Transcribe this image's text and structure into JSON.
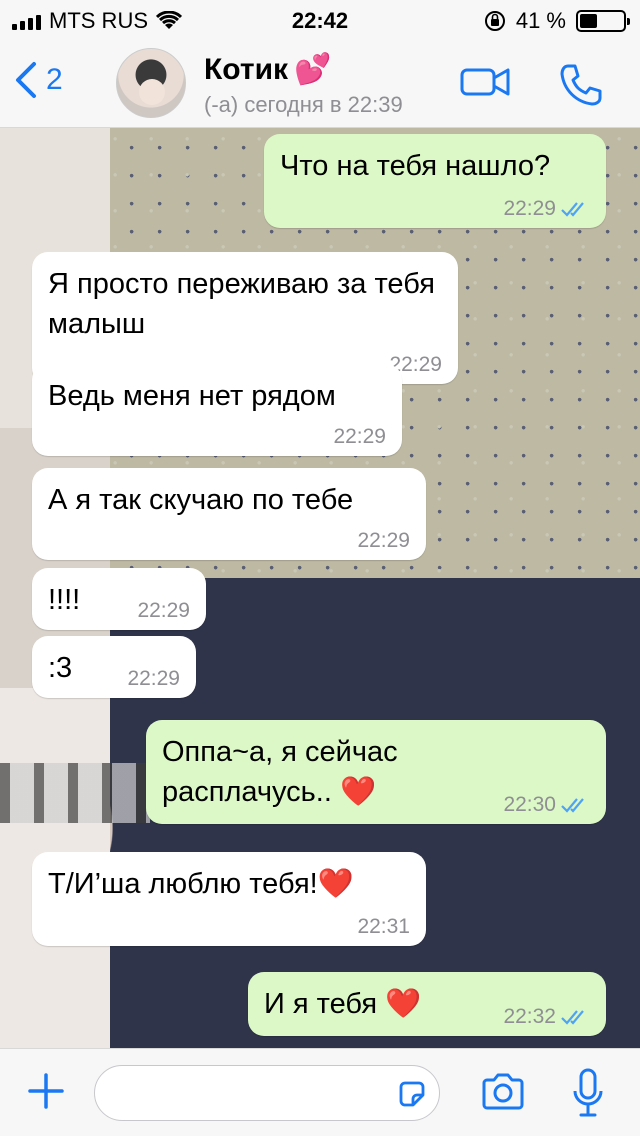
{
  "status_bar": {
    "carrier": "MTS RUS",
    "time": "22:42",
    "battery": "41 %",
    "battery_level": 0.41
  },
  "header": {
    "back_count": "2",
    "contact_name": "Котик",
    "contact_emoji": "💕",
    "status": "(-а) сегодня в 22:39"
  },
  "messages": [
    {
      "direction": "out",
      "text": "Что на тебя нашло?",
      "time": "22:29",
      "read": true
    },
    {
      "direction": "in",
      "text": "Я просто переживаю за тебя малыш",
      "time": "22:29"
    },
    {
      "direction": "in",
      "text": "Ведь меня нет рядом",
      "time": "22:29"
    },
    {
      "direction": "in",
      "text": "А я так скучаю по тебе",
      "time": "22:29"
    },
    {
      "direction": "in",
      "text": "!!!!",
      "time": "22:29"
    },
    {
      "direction": "in",
      "text": ":3",
      "time": "22:29"
    },
    {
      "direction": "out",
      "text": "Оппа~а, я сейчас расплачусь..",
      "emoji": "❤️",
      "time": "22:30",
      "read": true
    },
    {
      "direction": "in",
      "text": "Т/И’ша люблю тебя!",
      "emoji": "❤️",
      "time": "22:31"
    },
    {
      "direction": "out",
      "text": "И я тебя",
      "emoji": "❤️",
      "time": "22:32",
      "read": true
    }
  ],
  "input": {
    "value": ""
  },
  "colors": {
    "accent": "#1a78f2",
    "outgoing_bubble": "#dcf8c6",
    "incoming_bubble": "#ffffff",
    "read_ticks": "#4fa3f7"
  },
  "icons": [
    "back-chevron-icon",
    "video-call-icon",
    "phone-icon",
    "plus-icon",
    "sticker-icon",
    "camera-icon",
    "microphone-icon",
    "double-check-icon",
    "wifi-icon",
    "orientation-lock-icon"
  ]
}
